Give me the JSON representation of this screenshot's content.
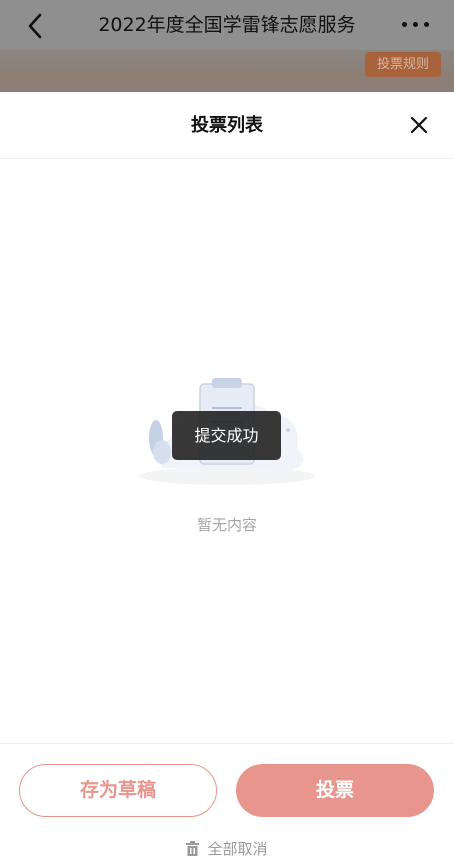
{
  "nav": {
    "title": "2022年度全国学雷锋志愿服务",
    "rules_label": "投票规则"
  },
  "panel": {
    "title": "投票列表",
    "empty_text": "暂无内容"
  },
  "toast": {
    "message": "提交成功"
  },
  "footer": {
    "draft_label": "存为草稿",
    "vote_label": "投票",
    "cancel_all_label": "全部取消"
  },
  "colors": {
    "accent": "#e8958e",
    "rules_bg": "#a8633c",
    "overlay": "#8f8f8f"
  }
}
